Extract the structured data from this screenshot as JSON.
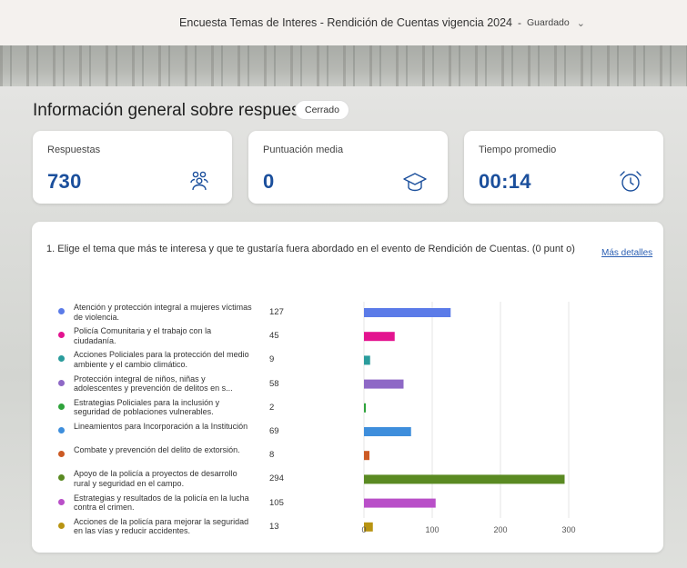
{
  "header": {
    "title": "Encuesta Temas de Interes - Rendición de Cuentas vigencia 2024",
    "separator": "-",
    "status": "Guardado",
    "chevron_icon": "chevron-down-icon"
  },
  "overview": {
    "title": "Información general sobre respuestas",
    "badge": "Cerrado"
  },
  "cards": [
    {
      "label": "Respuestas",
      "value": "730",
      "icon": "people-icon",
      "icon_color": "#1b4f9c"
    },
    {
      "label": "Puntuación media",
      "value": "0",
      "icon": "graduation-cap-icon",
      "icon_color": "#1b4f9c"
    },
    {
      "label": "Tiempo promedio",
      "value": "00:14",
      "icon": "alarm-clock-icon",
      "icon_color": "#1b4f9c"
    }
  ],
  "question": {
    "text": "1. Elige el tema que más te interesa y que te gustaría fuera abordado en el evento de Rendición de Cuentas. (0 punt o)",
    "more_details": "Más detalles"
  },
  "chart_data": {
    "type": "bar",
    "orientation": "horizontal",
    "categories": [
      "Atención y protección integral a mujeres víctimas de violencia.",
      "Policía Comunitaria y el trabajo con la ciudadanía.",
      "Acciones Policiales para la protección del medio ambiente y el cambio climático.",
      "Protección integral de niños, niñas y adolescentes y prevención de delitos en s...",
      "Estrategias Policiales para la inclusión y seguridad de poblaciones vulnerables.",
      "Lineamientos para Incorporación a la Institución",
      "Combate y prevención del delito de extorsión.",
      "Apoyo de la policía a proyectos de desarrollo rural y seguridad en el campo.",
      "Estrategias y resultados de la policía en la lucha contra el crimen.",
      "Acciones de la policía para mejorar la seguridad en las vías y reducir accidentes."
    ],
    "values": [
      127,
      45,
      9,
      58,
      2,
      69,
      8,
      294,
      105,
      13
    ],
    "colors": [
      "#5b7be8",
      "#e3138f",
      "#2a9c9c",
      "#8e68c6",
      "#2ea33b",
      "#3e8edc",
      "#cc5a24",
      "#5a8a22",
      "#b94fc8",
      "#b89412"
    ],
    "xlim": [
      0,
      300
    ],
    "xticks": [
      "0",
      "100",
      "200",
      "300"
    ],
    "grid": true
  }
}
